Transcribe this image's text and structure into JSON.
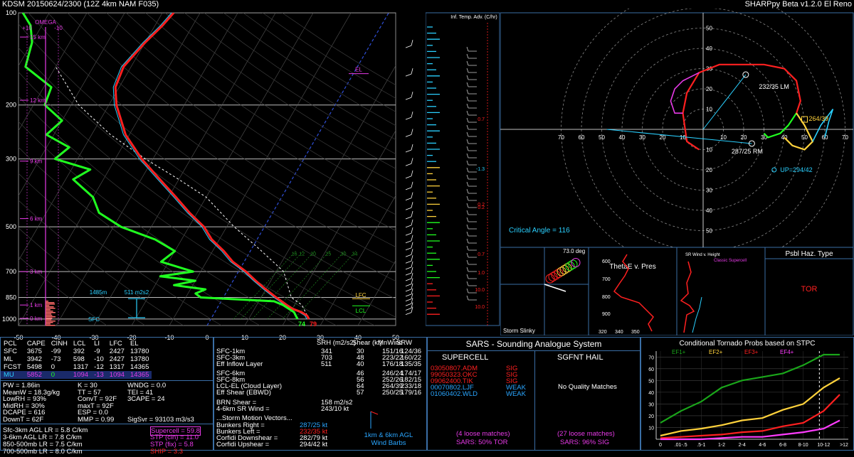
{
  "header": {
    "left": "KDSM   20150624/2300  (12Z  4km NAM  F035)",
    "right": "SHARPpy Beta v1.2.0 El Reno"
  },
  "skewt": {
    "pressure_ticks": [
      "100",
      "200",
      "300",
      "500",
      "700",
      "850",
      "1000"
    ],
    "temp_ticks": [
      "-50",
      "-40",
      "-30",
      "-20",
      "-10",
      "0",
      "10",
      "20",
      "30",
      "40",
      "50"
    ],
    "height_labels": [
      "15 km",
      "12 km",
      "9 km",
      "6 km",
      "3 km",
      "1 km",
      "0 km"
    ],
    "omega_label": "OMEGA",
    "omega_plus": "+10",
    "omega_minus": "-10",
    "el_label": "EL",
    "lfc_label": "LFC",
    "lcl_label": "LCL",
    "sfc_label": "SFC",
    "srh_height": "1485m",
    "srh_value": "511 m2s2",
    "sfc_td": "74",
    "sfc_t": "79",
    "mix_ratios": [
      "16",
      "12",
      "20",
      "25",
      "30",
      "34"
    ]
  },
  "chart_data": [
    {
      "type": "line",
      "title": "",
      "xlabel": "",
      "ylabel": "",
      "x_axis": "temperature C (skewed)",
      "y_axis": "pressure hPa (log)",
      "ylim": [
        1000,
        100
      ],
      "xlim": [
        -50,
        50
      ],
      "series": [
        {
          "name": "",
          "color": "#ff2020",
          "points": [
            [
              26,
              1000
            ],
            [
              25,
              975
            ],
            [
              23,
              950
            ],
            [
              20,
              925
            ],
            [
              18,
              900
            ],
            [
              16,
              875
            ],
            [
              14,
              850
            ],
            [
              10,
              800
            ],
            [
              6,
              750
            ],
            [
              2,
              700
            ],
            [
              -3,
              650
            ],
            [
              -7,
              600
            ],
            [
              -12,
              550
            ],
            [
              -16,
              500
            ],
            [
              -22,
              450
            ],
            [
              -28,
              400
            ],
            [
              -35,
              350
            ],
            [
              -43,
              300
            ],
            [
              -51,
              250
            ],
            [
              -58,
              200
            ],
            [
              -61,
              175
            ],
            [
              -62,
              150
            ],
            [
              -60,
              125
            ],
            [
              -58,
              110
            ],
            [
              -57,
              100
            ]
          ]
        },
        {
          "name": "",
          "color": "#20ff20",
          "points": [
            [
              23,
              1000
            ],
            [
              22,
              975
            ],
            [
              21,
              950
            ],
            [
              19,
              925
            ],
            [
              17,
              900
            ],
            [
              14,
              875
            ],
            [
              -6,
              850
            ],
            [
              -8,
              825
            ],
            [
              -6,
              800
            ],
            [
              -15,
              775
            ],
            [
              -10,
              750
            ],
            [
              -20,
              725
            ],
            [
              -12,
              700
            ],
            [
              -22,
              650
            ],
            [
              -20,
              600
            ],
            [
              -27,
              550
            ],
            [
              -38,
              500
            ],
            [
              -46,
              450
            ],
            [
              -50,
              400
            ],
            [
              -58,
              350
            ],
            [
              -55,
              325
            ],
            [
              -66,
              300
            ],
            [
              -64,
              275
            ],
            [
              -72,
              250
            ],
            [
              -70,
              225
            ],
            [
              -77,
              200
            ],
            [
              -78,
              175
            ],
            [
              -88,
              150
            ],
            [
              -90,
              125
            ],
            [
              -93,
              110
            ],
            [
              -97,
              100
            ]
          ]
        }
      ]
    },
    {
      "type": "scatter",
      "title": "",
      "x_axis": "u kt",
      "y_axis": "v kt",
      "rings": [
        "10",
        "20",
        "30",
        "40",
        "50",
        "60",
        "70"
      ],
      "critical_angle": "Critical Angle = 116",
      "lm_label": "232/35 LM",
      "rm_label": "287/25 RM",
      "mean_label": "264/39",
      "up_label": "UP=294/42"
    },
    {
      "type": "bar",
      "title": "Conditional Tornado Probs based on STPC",
      "categories": [
        "0",
        ".01-.5",
        ".5-1",
        "1-2",
        "2-4",
        "4-6",
        "6-8",
        "8-10",
        "10-12",
        ">12"
      ],
      "yticks": [
        "10",
        "20",
        "30",
        "40",
        "50",
        "60",
        "70"
      ],
      "ylim": [
        0,
        75
      ],
      "series": [
        {
          "name": "EF1+",
          "color": "#1aa61a",
          "values": [
            14,
            24,
            32,
            44,
            50,
            53,
            56,
            63,
            72,
            72
          ]
        },
        {
          "name": "EF2+",
          "color": "#ffd23c",
          "values": [
            3,
            7,
            9,
            12,
            16,
            18,
            25,
            30,
            44,
            52
          ]
        },
        {
          "name": "EF3+",
          "color": "#ff2020",
          "values": [
            1,
            2,
            3,
            4,
            6,
            7,
            11,
            14,
            24,
            38
          ]
        },
        {
          "name": "EF4+",
          "color": "#ff3cff",
          "values": [
            0,
            0,
            0,
            1,
            2,
            2,
            4,
            6,
            9,
            16
          ]
        }
      ]
    }
  ],
  "tempadv": {
    "title": "Inf. Temp. Adv. (C/hr)",
    "values": [
      "0.7",
      "-1.3",
      "0.2",
      "0.2",
      "0.7",
      "1.0",
      "10.0",
      "10.0"
    ]
  },
  "storm_slinky": {
    "label": "Storm Slinky",
    "angle": "73.0 deg"
  },
  "thetae": {
    "title": "ThetaE v. Pres",
    "yticks": [
      "600",
      "700",
      "800",
      "900"
    ],
    "xticks": [
      "320",
      "340",
      "350"
    ]
  },
  "srwind": {
    "title": "SR Wind v. Height",
    "classic": "Classic Supercell"
  },
  "hazard": {
    "title": "Psbl Haz. Type",
    "value": "TOR"
  },
  "parcels": {
    "headers": [
      "PCL",
      "CAPE",
      "CINH",
      "LCL",
      "LI",
      "LFC",
      "EL"
    ],
    "rows": [
      [
        "SFC",
        "3675",
        "-99",
        "392",
        "-9",
        "2427",
        "13780"
      ],
      [
        "ML",
        "3942",
        "-73",
        "598",
        "-10",
        "2427",
        "13780"
      ],
      [
        "FCST",
        "5498",
        "0",
        "1317",
        "-12",
        "1317",
        "14365"
      ],
      [
        "MU",
        "5852",
        "0",
        "1094",
        "-13",
        "1094",
        "14365"
      ]
    ]
  },
  "thermo": [
    [
      "PW = 1.86in",
      "K = 30",
      "WNDG = 0.0"
    ],
    [
      "MeanW = 18.3g/kg",
      "TT = 57",
      "TEI = 41"
    ],
    [
      "LowRH = 93%",
      "ConvT = 92F",
      "3CAPE = 24"
    ],
    [
      "MidRH = 30%",
      "maxT = 92F",
      ""
    ],
    [
      "DCAPE = 616",
      "ESP = 0.0",
      ""
    ],
    [
      "DownT = 62F",
      "MMP = 0.99",
      "SigSvr = 93103 m3/s3"
    ]
  ],
  "lapse": [
    "Sfc-3km AGL LR = 5.8 C/km",
    "3-6km AGL LR = 7.8 C/km",
    "850-500mb LR = 7.5 C/km",
    "700-500mb LR = 8.0 C/km"
  ],
  "composites": [
    "Supercell = 59.8",
    "STP (cin) = 11.0",
    "STP (fix) = 5.8",
    "SHIP = 3.3"
  ],
  "kinematics": {
    "headers": [
      "",
      "SRH (m2/s2)",
      "Shear (kt)",
      "MnWind",
      "SRW"
    ],
    "rows": [
      [
        "SFC-1km",
        "341",
        "30",
        "151/16",
        "124/36"
      ],
      [
        "SFC-3km",
        "703",
        "48",
        "223/22",
        "160/22"
      ],
      [
        "Eff Inflow Layer",
        "511",
        "40",
        "176/18",
        "135/35"
      ],
      [
        "SFC-6km",
        "",
        "46",
        "246/24",
        "174/17"
      ],
      [
        "SFC-8km",
        "",
        "56",
        "252/26",
        "182/15"
      ],
      [
        "LCL-EL (Cloud Layer)",
        "",
        "64",
        "264/39",
        "233/18"
      ],
      [
        "Eff Shear (EBWD)",
        "",
        "57",
        "250/25",
        "179/16"
      ]
    ],
    "brn_label": "BRN Shear =",
    "brn_value": "158 m2/s2",
    "srw46_label": "4-6km SR Wind =",
    "srw46_value": "243/10 kt",
    "motion_title": "...Storm Motion Vectors...",
    "motions": [
      [
        "Bunkers Right =",
        "287/25 kt"
      ],
      [
        "Bunkers Left =",
        "232/35 kt"
      ],
      [
        "Corfidi Downshear =",
        "282/79 kt"
      ],
      [
        "Corfidi Upshear =",
        "294/42 kt"
      ]
    ],
    "barbs_label": "1km & 6km AGL Wind Barbs"
  },
  "sars": {
    "title": "SARS - Sounding Analogue System",
    "supercell_title": "SUPERCELL",
    "hail_title": "SGFNT HAIL",
    "matches": [
      [
        "03050807.ADM",
        "SIG",
        "#ff2020"
      ],
      [
        "99050323.OKC",
        "SIG",
        "#ff2020"
      ],
      [
        "09062400.TIK",
        "SIG",
        "#ff2020"
      ],
      [
        "00070802.LJF",
        "WEAK",
        "#2aa6ff"
      ],
      [
        "01060402.WLD",
        "WEAK",
        "#2aa6ff"
      ]
    ],
    "hail_none": "No Quality Matches",
    "loose_left": "(4 loose matches)",
    "loose_right": "(27 loose matches)",
    "prob_left": "SARS: 50% TOR",
    "prob_right": "SARS: 96% SIG"
  }
}
